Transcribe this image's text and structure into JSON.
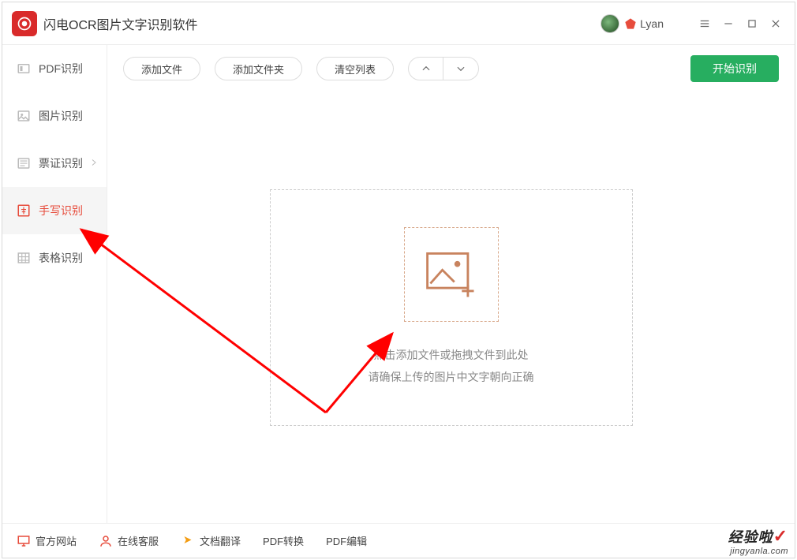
{
  "app": {
    "title": "闪电OCR图片文字识别软件"
  },
  "user": {
    "name": "Lyan"
  },
  "sidebar": {
    "items": [
      {
        "label": "PDF识别"
      },
      {
        "label": "图片识别"
      },
      {
        "label": "票证识别"
      },
      {
        "label": "手写识别"
      },
      {
        "label": "表格识别"
      }
    ]
  },
  "toolbar": {
    "add_file": "添加文件",
    "add_folder": "添加文件夹",
    "clear_list": "清空列表",
    "start": "开始识别"
  },
  "dropzone": {
    "line1": "点击添加文件或拖拽文件到此处",
    "line2": "请确保上传的图片中文字朝向正确"
  },
  "statusbar": {
    "official_site": "官方网站",
    "online_service": "在线客服",
    "doc_translate": "文档翻译",
    "pdf_convert": "PDF转换",
    "pdf_edit": "PDF编辑"
  },
  "watermark": {
    "brand": "经验啦",
    "url": "jingyanla.com"
  }
}
